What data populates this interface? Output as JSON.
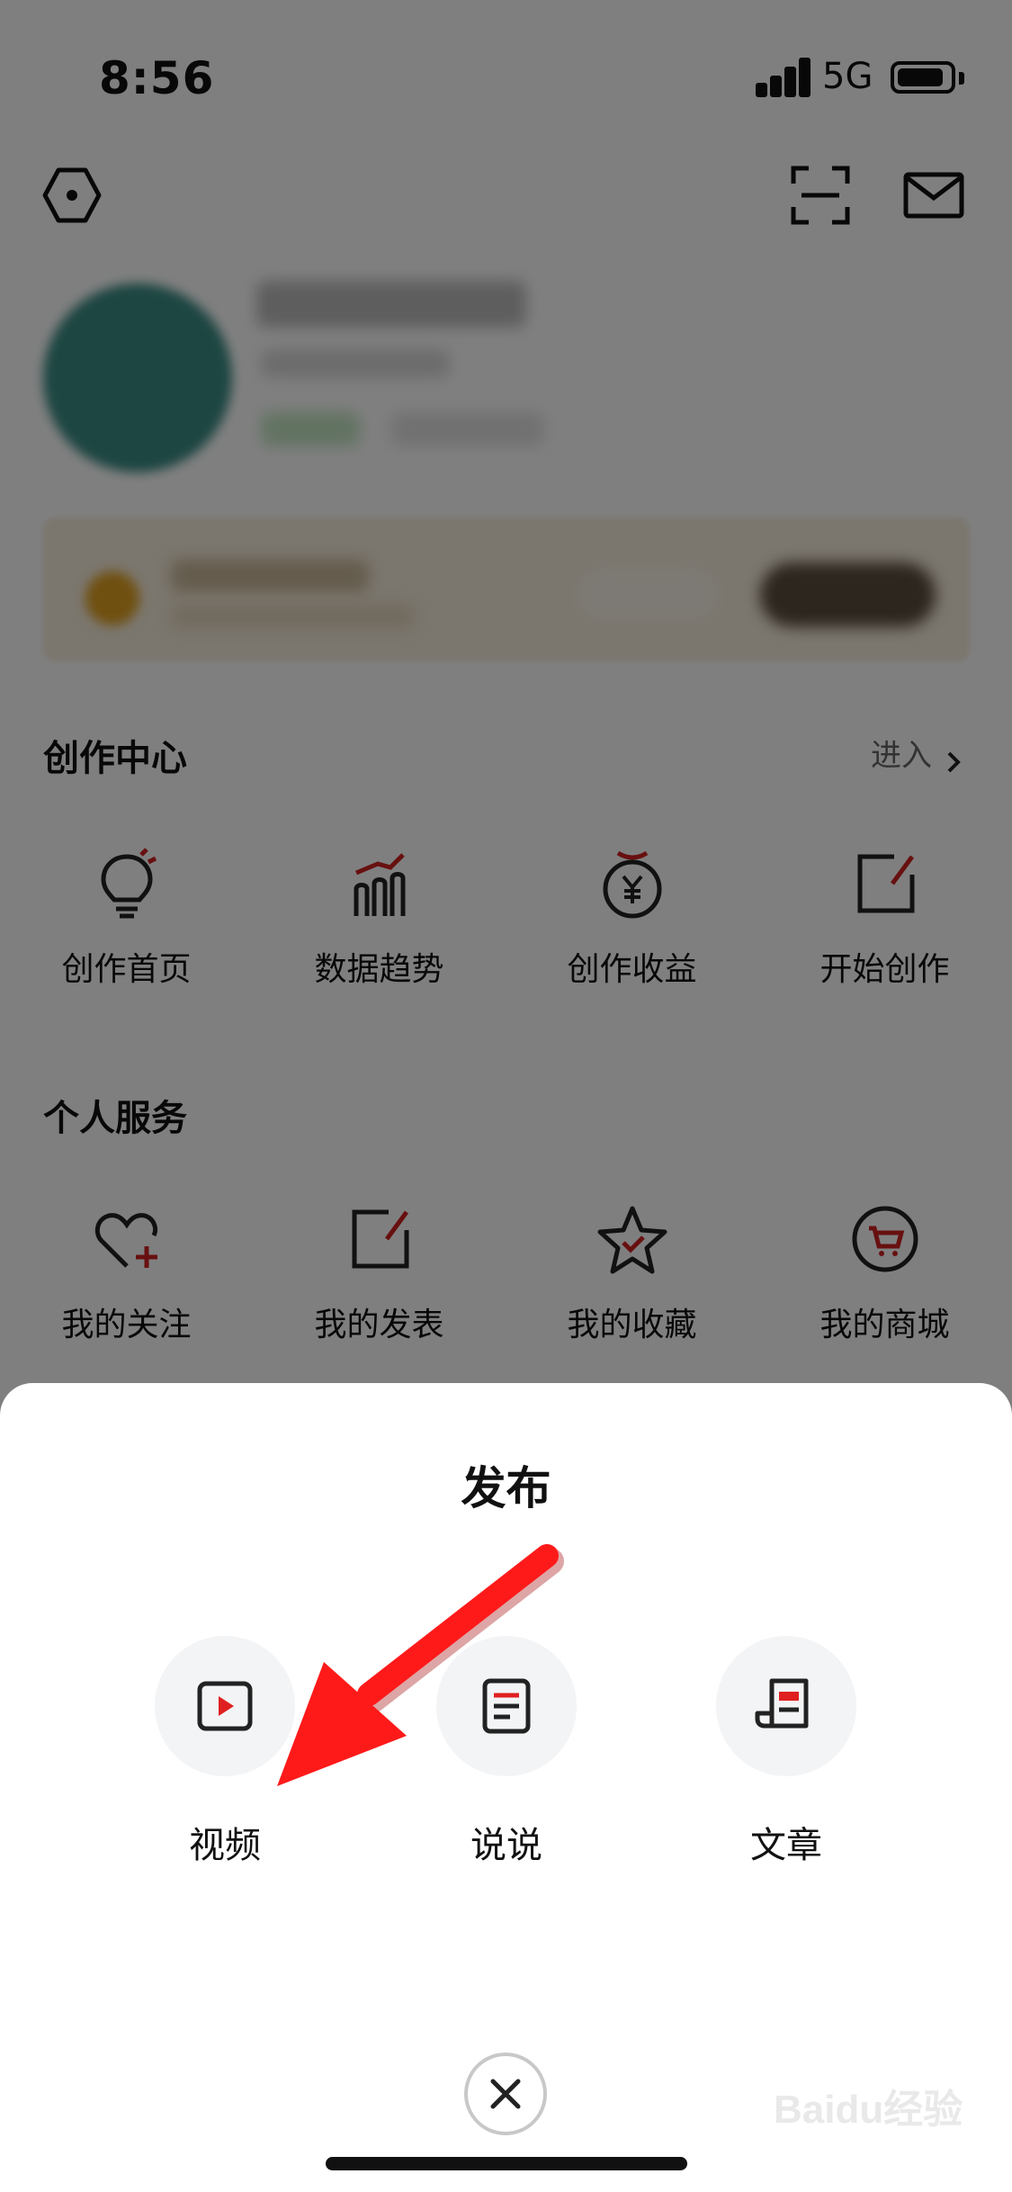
{
  "status_bar": {
    "time": "8:56",
    "network": "5G"
  },
  "sections": {
    "creation": {
      "title": "创作中心",
      "enter": "进入",
      "items": [
        {
          "label": "创作首页",
          "icon": "bulb-icon"
        },
        {
          "label": "数据趋势",
          "icon": "trend-chart-icon"
        },
        {
          "label": "创作收益",
          "icon": "yuan-coin-icon"
        },
        {
          "label": "开始创作",
          "icon": "edit-icon"
        }
      ]
    },
    "personal": {
      "title": "个人服务",
      "items": [
        {
          "label": "我的关注",
          "icon": "heart-plus-icon"
        },
        {
          "label": "我的发表",
          "icon": "edit-icon"
        },
        {
          "label": "我的收藏",
          "icon": "star-icon"
        },
        {
          "label": "我的商城",
          "icon": "cart-icon"
        }
      ]
    }
  },
  "sheet": {
    "title": "发布",
    "options": [
      {
        "label": "视频",
        "icon": "video-play-icon"
      },
      {
        "label": "说说",
        "icon": "note-icon"
      },
      {
        "label": "文章",
        "icon": "article-icon"
      }
    ]
  },
  "watermark": "Baidu经验",
  "colors": {
    "accent_red": "#e02020",
    "annotation_arrow": "#ff1a1a"
  }
}
